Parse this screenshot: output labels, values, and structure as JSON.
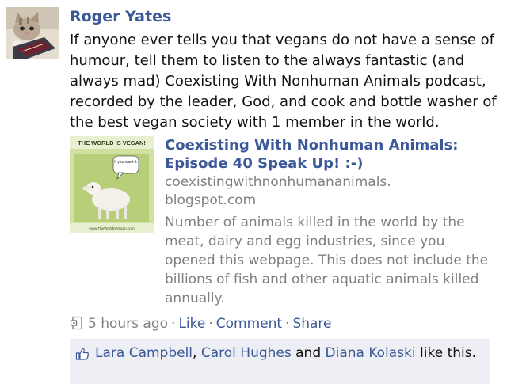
{
  "post": {
    "author": "Roger Yates",
    "message": "If anyone ever tells you that vegans do not have a sense of humour, tell them to listen to the always fantastic (and always mad) Coexisting With Nonhuman Animals podcast, recorded by the leader, God, and cook and bottle washer of the best vegan society with 1 member in the world."
  },
  "attachment": {
    "thumb_banner": "THE WORLD IS VEGAN!",
    "thumb_bubble": "If you want it.",
    "thumb_url": "www.TheWorldIsVegan.com",
    "title_line1": "Coexisting With Nonhuman Animals:",
    "title_line2": "Episode 40 Speak Up! :-)",
    "domain_line1": "coexistingwithnonhumananimals.",
    "domain_line2": "blogspot.com",
    "description": "Number of animals killed in the world by the meat, dairy and egg industries, since you opened this webpage. This does not include the billions of fish and other aquatic animals killed annually."
  },
  "actions": {
    "timestamp": "5 hours ago",
    "separator": "·",
    "like": "Like",
    "comment": "Comment",
    "share": "Share",
    "post_type_icon": "share-link-icon"
  },
  "likes": {
    "icon": "thumbs-up-icon",
    "name1": "Lara Campbell",
    "comma": ", ",
    "name2": "Carol Hughes",
    "and": " and ",
    "name3": "Diana Kolaski",
    "suffix": " like this."
  },
  "colors": {
    "link": "#3b5998",
    "muted": "#808080",
    "likes_bg": "#edeff4"
  }
}
